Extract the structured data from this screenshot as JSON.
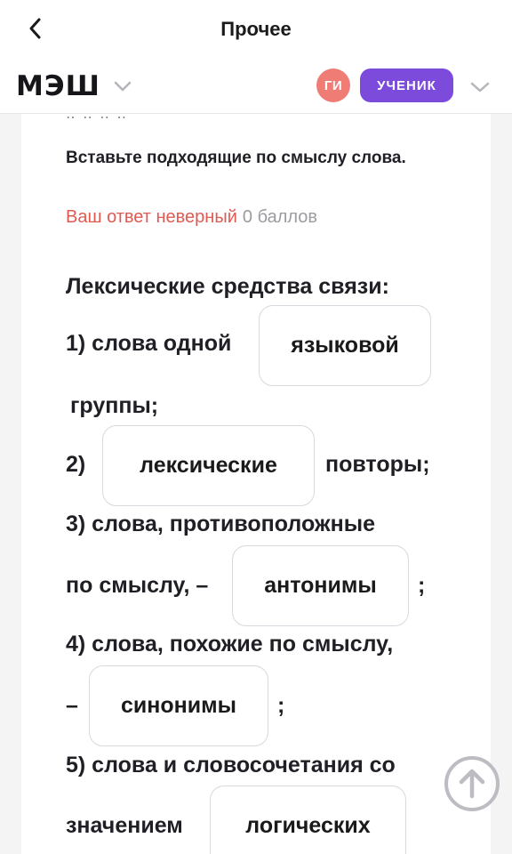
{
  "nav": {
    "title": "Прочее"
  },
  "header": {
    "logo": "МЭШ",
    "avatar_initials": "ГИ",
    "role_label": "УЧЕНИК"
  },
  "task": {
    "instruction": "Вставьте подходящие по смыслу слова.",
    "result_status": "Ваш ответ неверный",
    "result_score": "0 баллов"
  },
  "exercise": {
    "heading": "Лексические средства связи:",
    "line1_prefix": "1) слова одной",
    "line1_answer": "языковой",
    "line1_suffix": "группы;",
    "line2_prefix": "2)",
    "line2_answer": "лексические",
    "line2_suffix": "повторы;",
    "line3_text": "3) слова, противоположные",
    "line3_prefix": "по смыслу, –",
    "line3_answer": "антонимы",
    "line3_suffix": ";",
    "line4_text": "4) слова, похожие по смыслу,",
    "line4_prefix": "–",
    "line4_answer": "синонимы",
    "line4_suffix": ";",
    "line5_text": "5) слова и словосочетания со",
    "line5_prefix": "значением",
    "line5_answer": "логических"
  },
  "colors": {
    "avatar": "#ef7d75",
    "role_badge": "#7d4bdb",
    "wrong": "#e05a52",
    "score": "#9b9ba0"
  },
  "icons": {
    "back": "chevron-left-icon",
    "logo_menu": "chevron-down-icon",
    "role_menu": "chevron-down-icon",
    "scroll_top": "arrow-up-circle-icon"
  }
}
